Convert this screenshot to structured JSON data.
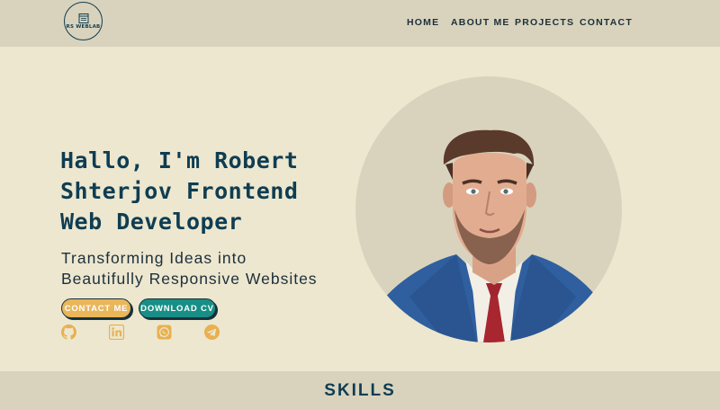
{
  "nav": {
    "logo_text": "RS WEBLAB",
    "logo_icon": "document-icon",
    "links": [
      "HOME",
      "ABOUT ME",
      "PROJECTS",
      "CONTACT"
    ]
  },
  "hero": {
    "title_lines": [
      "Hallo, I'm Robert",
      "Shterjov Frontend",
      "Web Developer"
    ],
    "subtitle_lines": [
      "Transforming Ideas into",
      "Beautifully Responsive Websites"
    ],
    "buttons": {
      "contact": "CONTACT ME",
      "download": "DOWNLOAD CV"
    },
    "socials": [
      "github-icon",
      "linkedin-icon",
      "whatsapp-icon",
      "telegram-icon"
    ],
    "portrait_alt": "portrait-photo"
  },
  "section": {
    "skills_title": "SKILLS"
  },
  "colors": {
    "background": "#ede7cf",
    "band": "#d9d3bd",
    "primary_text": "#0f3d52",
    "contact_button": "#e9b65a",
    "download_button": "#178f86",
    "social_icons": "#e8b04f"
  }
}
